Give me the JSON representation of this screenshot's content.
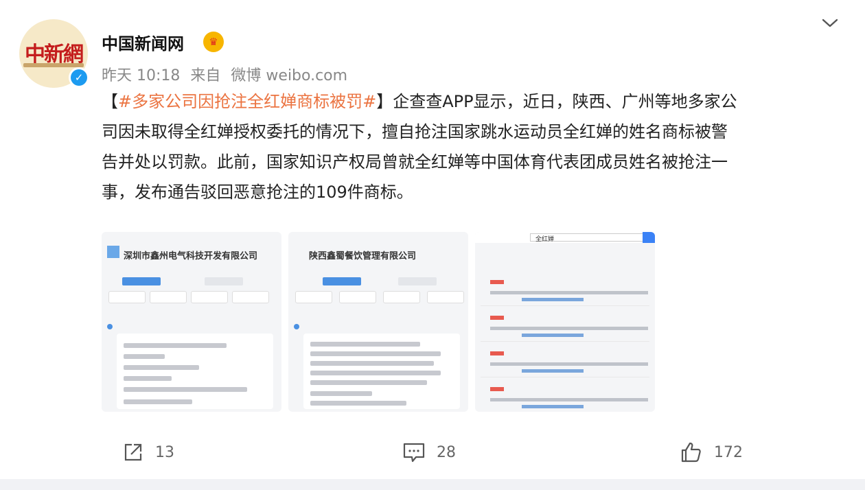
{
  "post": {
    "username": "中国新闻网",
    "avatar_text": "中新網",
    "meta": {
      "time": "昨天 10:18",
      "source_prefix": "来自",
      "source": "微博 weibo.com"
    },
    "content": {
      "bracket_open": "【",
      "hashtag": "#多家公司因抢注全红婵商标被罚#",
      "line1_rest": "】企查查APP显示，近日，陕西、广州等地多家公",
      "line2": "司因未取得全红婵授权委托的情况下，擅自抢注国家跳水运动员全红婵的姓名商标被警",
      "line3": "告并处以罚款。此前，国家知识产权局曾就全红婵等中国体育代表团成员姓名被抢注一",
      "line4": "事，发布通告驳回恶意抢注的109件商标。"
    },
    "images": [
      {
        "title": "深圳市鑫州电气科技开发有限公司"
      },
      {
        "title": "陕西鑫蜀餐饮管理有限公司"
      },
      {
        "title": "全红婵"
      }
    ]
  },
  "actions": {
    "share_count": "13",
    "comment_count": "28",
    "like_count": "172"
  },
  "icons": {
    "dropdown": "chevron-down-icon",
    "verified": "verified-badge-icon",
    "vip": "vip-crown-icon",
    "share": "share-icon",
    "comment": "comment-icon",
    "like": "thumbs-up-icon"
  },
  "colors": {
    "hashtag": "#eb7340",
    "verified": "#1d9bf0",
    "vip": "#f7b500"
  }
}
